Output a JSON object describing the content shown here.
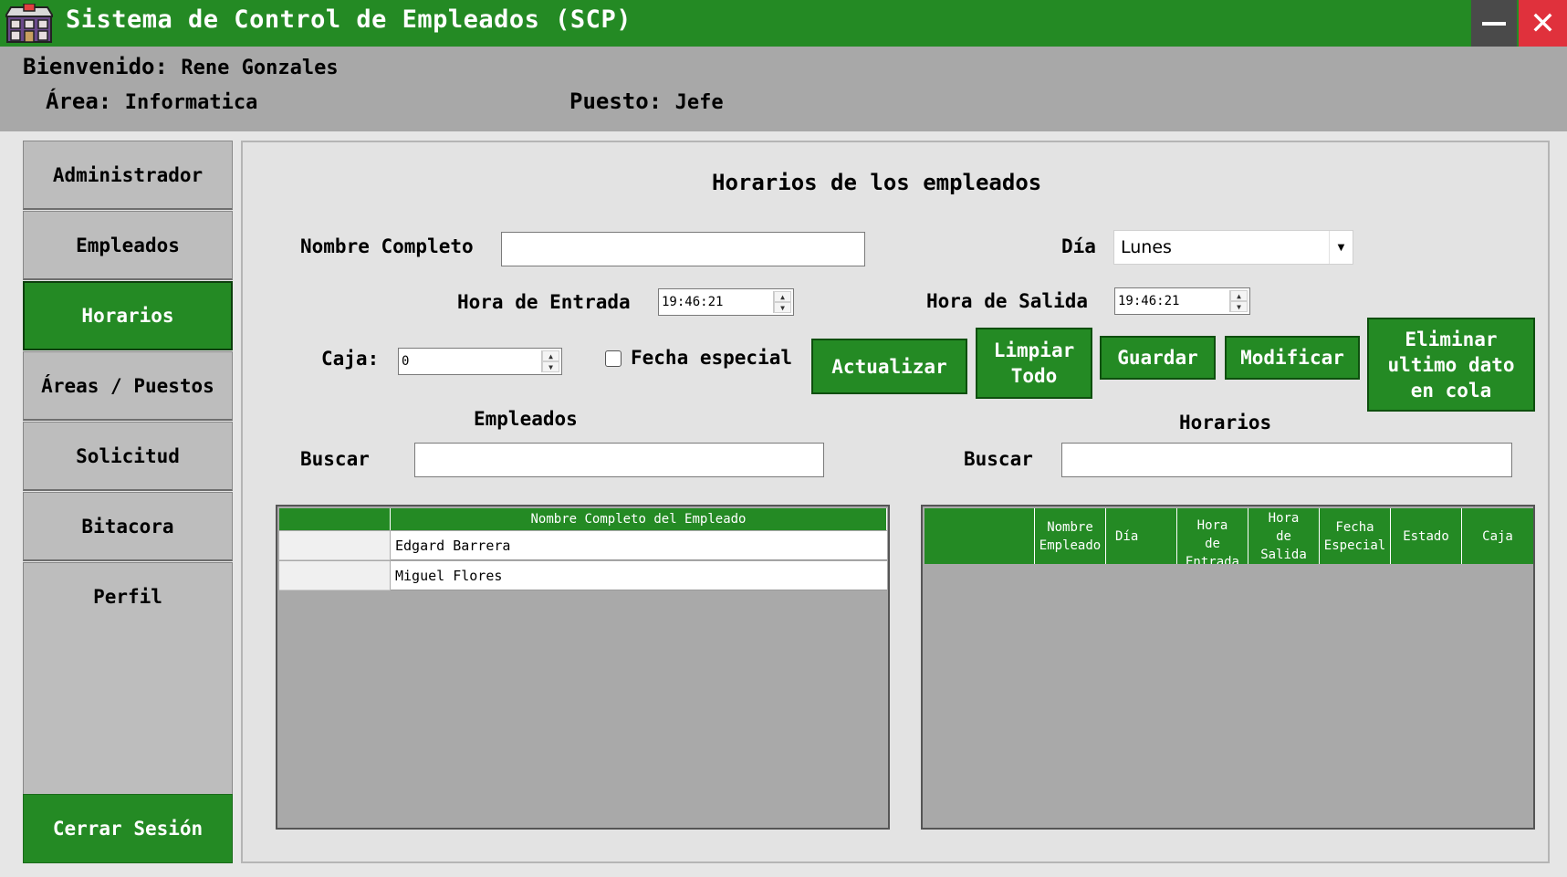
{
  "window": {
    "title": "Sistema de Control de Empleados (SCP)",
    "minimize_symbol": "—",
    "close_symbol": "✕",
    "accent_color": "#248a24",
    "close_color": "#e0313c"
  },
  "header": {
    "welcome_label": "Bienvenido:",
    "user_name": "Rene Gonzales",
    "area_label": "Área:",
    "area_value": "Informatica",
    "position_label": "Puesto:",
    "position_value": "Jefe"
  },
  "sidebar": {
    "items": [
      {
        "label": "Administrador",
        "active": false
      },
      {
        "label": "Empleados",
        "active": false
      },
      {
        "label": "Horarios",
        "active": true
      },
      {
        "label": "Áreas / Puestos",
        "active": false
      },
      {
        "label": "Solicitud",
        "active": false
      },
      {
        "label": "Bitacora",
        "active": false
      },
      {
        "label": "Perfil",
        "active": false
      }
    ],
    "logout_label": "Cerrar Sesión"
  },
  "form": {
    "title": "Horarios de los empleados",
    "full_name_label": "Nombre Completo",
    "full_name_value": "",
    "day_label": "Día",
    "day_value": "Lunes",
    "entry_label": "Hora de Entrada",
    "entry_value": "19:46:21",
    "exit_label": "Hora de Salida",
    "exit_value": "19:46:21",
    "box_label": "Caja:",
    "box_value": "0",
    "special_date_label": "Fecha especial",
    "special_date_checked": false
  },
  "actions": {
    "update": "Actualizar",
    "clear_line1": "Limpiar",
    "clear_line2": "Todo",
    "save": "Guardar",
    "modify": "Modificar",
    "delete_line1": "Eliminar",
    "delete_line2": "ultimo dato",
    "delete_line3": "en cola"
  },
  "employees": {
    "section_title": "Empleados",
    "search_label": "Buscar",
    "search_value": "",
    "columns": [
      "",
      "Nombre Completo del Empleado"
    ],
    "rows": [
      "Edgard Barrera",
      "Miguel Flores"
    ]
  },
  "schedules": {
    "section_title": "Horarios",
    "search_label": "Buscar",
    "search_value": "",
    "columns": [
      {
        "line1": "",
        "line2": "",
        "line3": ""
      },
      {
        "line1": "Nombre",
        "line2": "Empleado",
        "line3": ""
      },
      {
        "line1": "Día",
        "line2": "",
        "line3": ""
      },
      {
        "line1": "Hora",
        "line2": "de",
        "line3": "Entrada"
      },
      {
        "line1": "Hora",
        "line2": "de",
        "line3": "Salida"
      },
      {
        "line1": "Fecha",
        "line2": "Especial",
        "line3": ""
      },
      {
        "line1": "Estado",
        "line2": "",
        "line3": ""
      },
      {
        "line1": "Caja",
        "line2": "",
        "line3": ""
      }
    ]
  }
}
